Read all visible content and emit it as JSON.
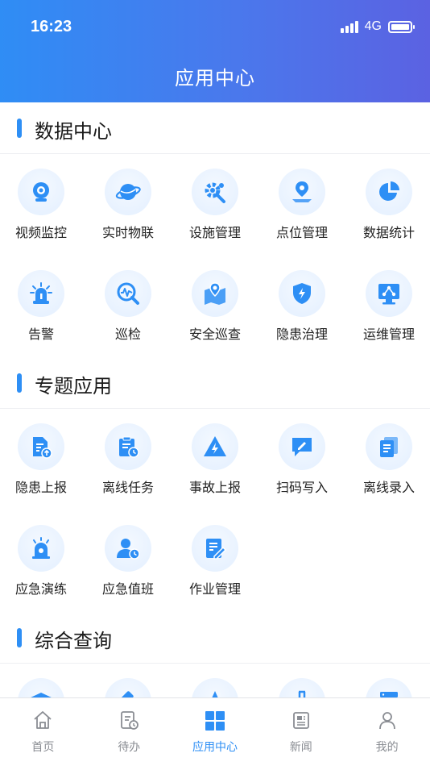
{
  "status_bar": {
    "time": "16:23",
    "network": "4G"
  },
  "header": {
    "title": "应用中心"
  },
  "sections": [
    {
      "title": "数据中心",
      "items": [
        {
          "label": "视频监控",
          "icon": "camera-icon"
        },
        {
          "label": "实时物联",
          "icon": "planet-icon"
        },
        {
          "label": "设施管理",
          "icon": "gear-wrench-icon"
        },
        {
          "label": "点位管理",
          "icon": "map-pin-icon"
        },
        {
          "label": "数据统计",
          "icon": "pie-chart-icon"
        },
        {
          "label": "告警",
          "icon": "siren-icon"
        },
        {
          "label": "巡检",
          "icon": "magnifier-pulse-icon"
        },
        {
          "label": "安全巡查",
          "icon": "map-location-icon"
        },
        {
          "label": "隐患治理",
          "icon": "shield-bolt-icon"
        },
        {
          "label": "运维管理",
          "icon": "monitor-network-icon"
        }
      ]
    },
    {
      "title": "专题应用",
      "items": [
        {
          "label": "隐患上报",
          "icon": "document-upload-icon"
        },
        {
          "label": "离线任务",
          "icon": "clipboard-clock-icon"
        },
        {
          "label": "事故上报",
          "icon": "warning-triangle-icon"
        },
        {
          "label": "扫码写入",
          "icon": "chat-pen-icon"
        },
        {
          "label": "离线录入",
          "icon": "documents-icon"
        },
        {
          "label": "应急演练",
          "icon": "alarm-light-icon"
        },
        {
          "label": "应急值班",
          "icon": "user-clock-icon"
        },
        {
          "label": "作业管理",
          "icon": "note-pen-icon"
        }
      ]
    },
    {
      "title": "综合查询",
      "items": [
        {
          "label": "",
          "icon": "graduation-cap-icon"
        },
        {
          "label": "",
          "icon": "gavel-icon"
        },
        {
          "label": "",
          "icon": "star-icon"
        },
        {
          "label": "",
          "icon": "flask-icon"
        },
        {
          "label": "",
          "icon": "server-icon"
        }
      ]
    }
  ],
  "tabbar": [
    {
      "label": "首页",
      "icon": "home-icon",
      "active": false
    },
    {
      "label": "待办",
      "icon": "todo-icon",
      "active": false
    },
    {
      "label": "应用中心",
      "icon": "apps-grid-icon",
      "active": true
    },
    {
      "label": "新闻",
      "icon": "news-icon",
      "active": false
    },
    {
      "label": "我的",
      "icon": "user-icon",
      "active": false
    }
  ],
  "colors": {
    "accent": "#2e8ff5",
    "icon_bg": "#e6f1ff",
    "header_start": "#2f8df5",
    "header_end": "#5b62e2"
  }
}
